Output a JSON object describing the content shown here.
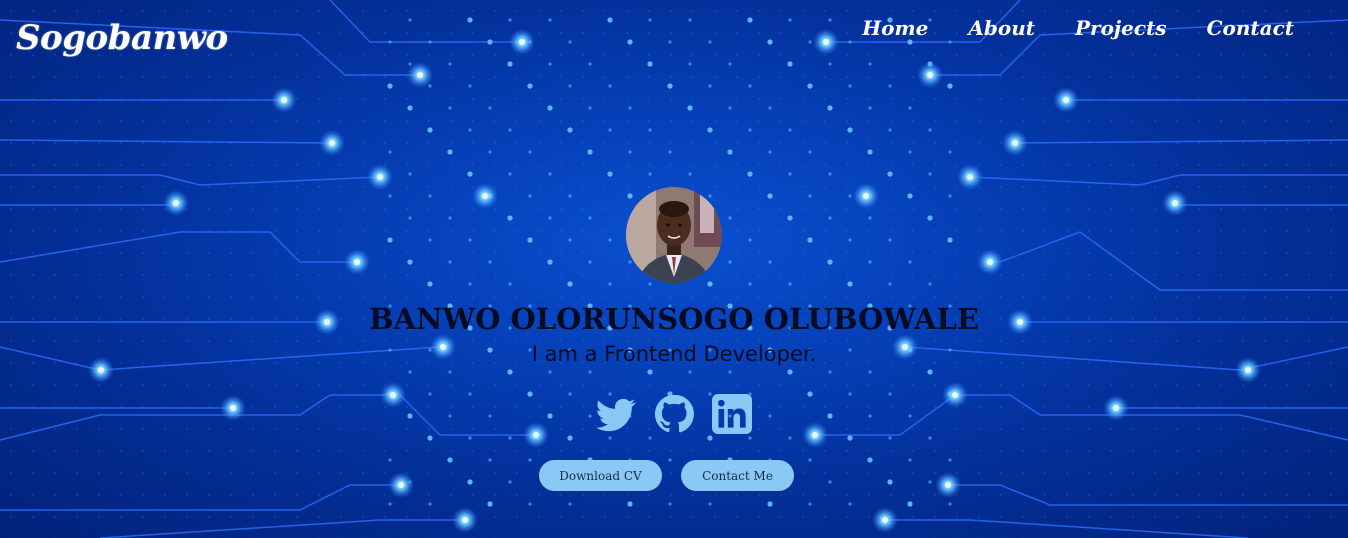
{
  "brand": {
    "logo": "Sogobanwo"
  },
  "nav": {
    "items": [
      {
        "label": "Home"
      },
      {
        "label": "About"
      },
      {
        "label": "Projects"
      },
      {
        "label": "Contact"
      }
    ]
  },
  "hero": {
    "name": "BANWO OLORUNSOGO OLUBOWALE",
    "tagline": "I am a Frontend Developer.",
    "socials": [
      {
        "icon": "twitter-icon"
      },
      {
        "icon": "github-icon"
      },
      {
        "icon": "linkedin-icon"
      }
    ],
    "buttons": {
      "download_cv": "Download CV",
      "contact_me": "Contact Me"
    }
  },
  "colors": {
    "background": "#0640b8",
    "icon": "#8ac8f5",
    "button": "#8ac8f5",
    "heading": "#050c22"
  }
}
